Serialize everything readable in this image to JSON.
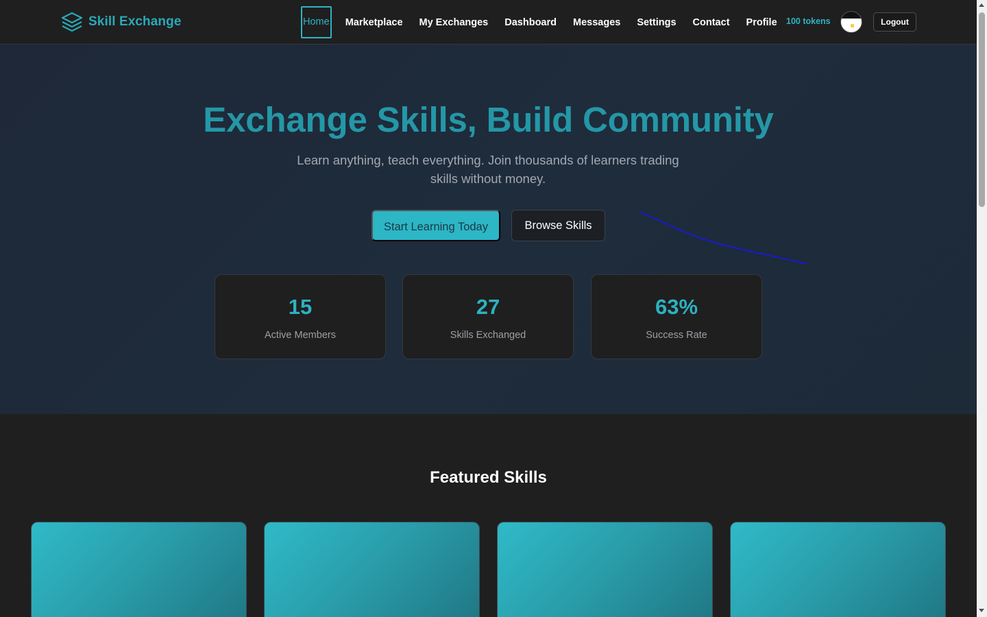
{
  "brand": {
    "name": "Skill Exchange",
    "logo_icon": "layers-icon",
    "color": "#2aa9b8"
  },
  "nav": {
    "items": [
      {
        "label": "Home",
        "active": true
      },
      {
        "label": "Marketplace"
      },
      {
        "label": "My Exchanges"
      },
      {
        "label": "Dashboard"
      },
      {
        "label": "Messages"
      },
      {
        "label": "Settings"
      },
      {
        "label": "Contact"
      },
      {
        "label": "Profile"
      }
    ],
    "tokens": "100 tokens",
    "avatar_icon": "user-avatar",
    "logout_label": "Logout"
  },
  "hero": {
    "title": "Exchange Skills, Build Community",
    "subtitle": "Learn anything, teach everything. Join thousands of learners trading skills without money.",
    "primary_button": "Start Learning Today",
    "secondary_button": "Browse Skills",
    "stats": [
      {
        "value": "15",
        "label": "Active Members"
      },
      {
        "value": "27",
        "label": "Skills Exchanged"
      },
      {
        "value": "63%",
        "label": "Success Rate"
      }
    ]
  },
  "featured": {
    "title": "Featured Skills",
    "card_count": 4
  },
  "colors": {
    "accent": "#2cb6c6",
    "background": "#1f1f1f",
    "hero_background": "#1e2a3a",
    "annotation_stroke": "#1a1acc"
  }
}
